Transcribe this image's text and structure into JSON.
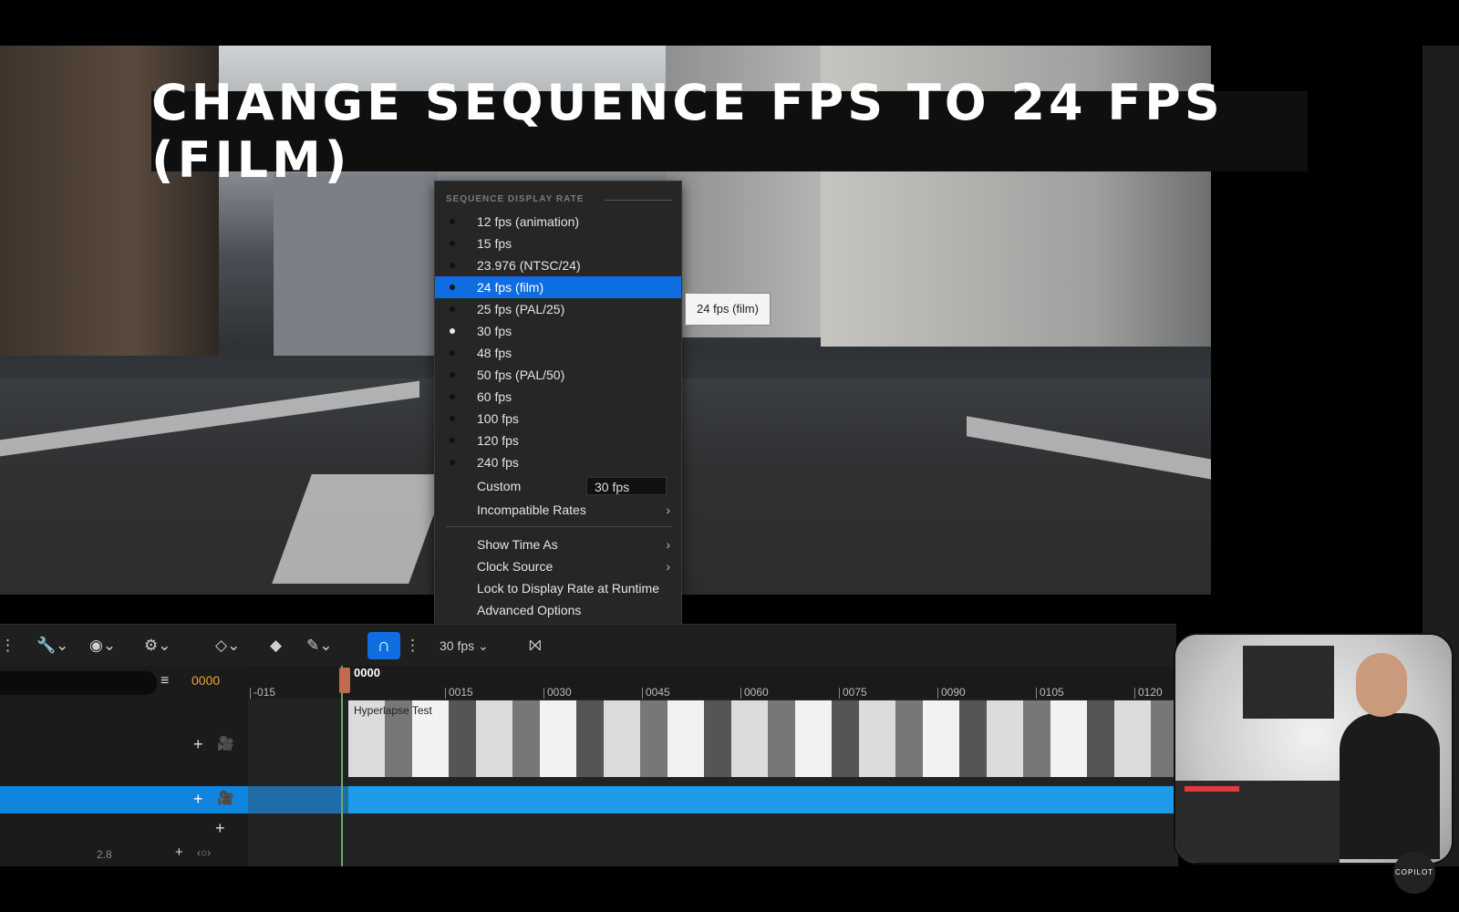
{
  "title_banner": "CHANGE SEQUENCE FPS TO 24 FPS (FILM)",
  "menu": {
    "header": "SEQUENCE DISPLAY RATE",
    "rates": [
      {
        "label": "12 fps (animation)",
        "selected": false,
        "highlighted": false
      },
      {
        "label": "15 fps",
        "selected": false,
        "highlighted": false
      },
      {
        "label": "23.976 (NTSC/24)",
        "selected": false,
        "highlighted": false
      },
      {
        "label": "24 fps (film)",
        "selected": false,
        "highlighted": true
      },
      {
        "label": "25 fps (PAL/25)",
        "selected": false,
        "highlighted": false
      },
      {
        "label": "30 fps",
        "selected": true,
        "highlighted": false
      },
      {
        "label": "48 fps",
        "selected": false,
        "highlighted": false
      },
      {
        "label": "50 fps (PAL/50)",
        "selected": false,
        "highlighted": false
      },
      {
        "label": "60 fps",
        "selected": false,
        "highlighted": false
      },
      {
        "label": "100 fps",
        "selected": false,
        "highlighted": false
      },
      {
        "label": "120 fps",
        "selected": false,
        "highlighted": false
      },
      {
        "label": "240 fps",
        "selected": false,
        "highlighted": false
      }
    ],
    "custom_label": "Custom",
    "custom_value": "30 fps",
    "incompatible_label": "Incompatible Rates",
    "show_time_as": "Show Time As",
    "clock_source": "Clock Source",
    "lock_display": "Lock to Display Rate at Runtime",
    "advanced": "Advanced Options"
  },
  "tooltip": "24 fps (film)",
  "toolbar": {
    "fps_label": "30 fps"
  },
  "timeline": {
    "frame_counter": "0000",
    "playhead_label": "0000",
    "ticks": [
      "-015",
      "0015",
      "0030",
      "0045",
      "0060",
      "0075",
      "0090",
      "0105",
      "0120"
    ],
    "clip_label": "Hyperlapse Test",
    "bottom_value": "2.8"
  },
  "watermark": "COPILOT"
}
